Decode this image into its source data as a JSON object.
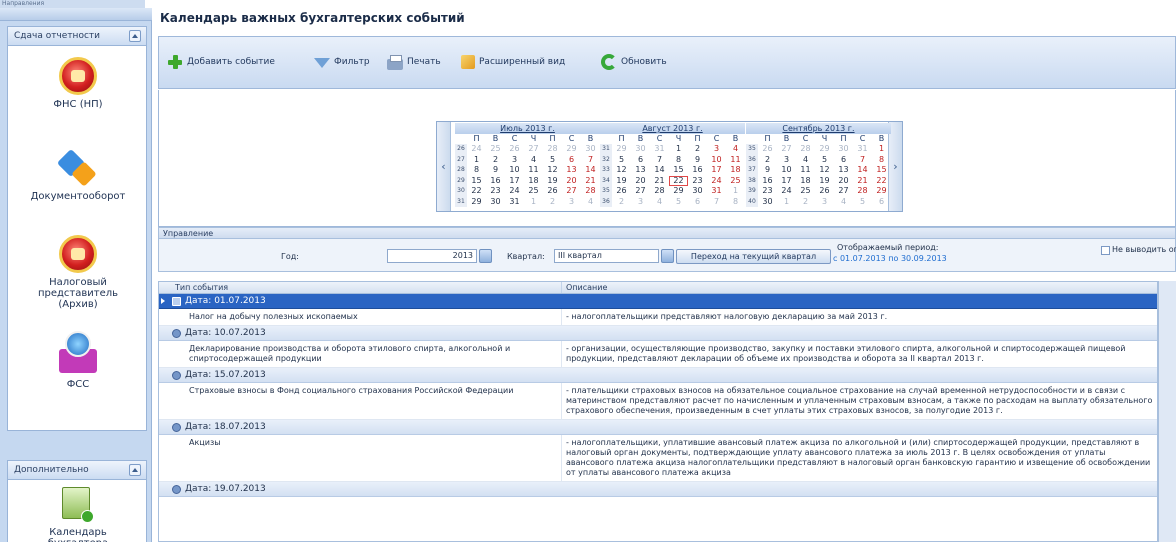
{
  "window": {
    "top_label": "Направления",
    "title": "Календарь важных бухгалтерских событий"
  },
  "nav": {
    "panel1_title": "Сдача отчетности",
    "panel2_title": "Дополнительно",
    "items": [
      {
        "label": "ФНС (НП)",
        "icon": "fns-eagle-icon"
      },
      {
        "label": "Документооборот",
        "icon": "docflow-icon"
      },
      {
        "label": "Налоговый представитель (Архив)",
        "icon": "tax-rep-eagle-icon"
      },
      {
        "label": "ФСС",
        "icon": "fss-icon"
      },
      {
        "label": "Календарь бухгалтера",
        "icon": "calendar-icon"
      }
    ]
  },
  "toolbar": {
    "add": "Добавить событие",
    "filter": "Фильтр",
    "print": "Печать",
    "extended": "Расширенный вид",
    "refresh": "Обновить"
  },
  "calendar": {
    "weekdays": [
      "П",
      "В",
      "С",
      "Ч",
      "П",
      "С",
      "В"
    ],
    "months": [
      {
        "title": "Июль 2013 г.",
        "weeks": [
          {
            "n": "26",
            "days": [
              "24",
              "25",
              "26",
              "27",
              "28",
              "29",
              "30"
            ]
          },
          {
            "n": "27",
            "days": [
              "1",
              "2",
              "3",
              "4",
              "5",
              "6",
              "7"
            ]
          },
          {
            "n": "28",
            "days": [
              "8",
              "9",
              "10",
              "11",
              "12",
              "13",
              "14"
            ]
          },
          {
            "n": "29",
            "days": [
              "15",
              "16",
              "17",
              "18",
              "19",
              "20",
              "21"
            ]
          },
          {
            "n": "30",
            "days": [
              "22",
              "23",
              "24",
              "25",
              "26",
              "27",
              "28"
            ]
          },
          {
            "n": "31",
            "days": [
              "29",
              "30",
              "31",
              "1",
              "2",
              "3",
              "4"
            ]
          }
        ]
      },
      {
        "title": "Август 2013 г.",
        "weeks": [
          {
            "n": "31",
            "days": [
              "29",
              "30",
              "31",
              "1",
              "2",
              "3",
              "4"
            ]
          },
          {
            "n": "32",
            "days": [
              "5",
              "6",
              "7",
              "8",
              "9",
              "10",
              "11"
            ]
          },
          {
            "n": "33",
            "days": [
              "12",
              "13",
              "14",
              "15",
              "16",
              "17",
              "18"
            ]
          },
          {
            "n": "34",
            "days": [
              "19",
              "20",
              "21",
              "22",
              "23",
              "24",
              "25"
            ]
          },
          {
            "n": "35",
            "days": [
              "26",
              "27",
              "28",
              "29",
              "30",
              "31",
              "1"
            ]
          },
          {
            "n": "36",
            "days": [
              "2",
              "3",
              "4",
              "5",
              "6",
              "7",
              "8"
            ]
          }
        ]
      },
      {
        "title": "Сентябрь 2013 г.",
        "weeks": [
          {
            "n": "35",
            "days": [
              "26",
              "27",
              "28",
              "29",
              "30",
              "31",
              "1"
            ]
          },
          {
            "n": "36",
            "days": [
              "2",
              "3",
              "4",
              "5",
              "6",
              "7",
              "8"
            ]
          },
          {
            "n": "37",
            "days": [
              "9",
              "10",
              "11",
              "12",
              "13",
              "14",
              "15"
            ]
          },
          {
            "n": "38",
            "days": [
              "16",
              "17",
              "18",
              "19",
              "20",
              "21",
              "22"
            ]
          },
          {
            "n": "39",
            "days": [
              "23",
              "24",
              "25",
              "26",
              "27",
              "28",
              "29"
            ]
          },
          {
            "n": "40",
            "days": [
              "30",
              "1",
              "2",
              "3",
              "4",
              "5",
              "6"
            ]
          }
        ]
      }
    ]
  },
  "management": {
    "header": "Управление",
    "year_label": "Год:",
    "year_value": "2013",
    "quarter_label": "Квартал:",
    "quarter_value": "III квартал",
    "current_quarter_button": "Переход на текущий квартал",
    "period_label": "Отображаемый период:",
    "period_value": "с 01.07.2013   по 30.09.2013",
    "no_alerts_label": "Не выводить оповещения"
  },
  "grid": {
    "col_type": "Тип события",
    "col_desc": "Описание",
    "groups": [
      {
        "label": "Дата: 01.07.2013",
        "rows": [
          {
            "type": "Налог на добычу полезных ископаемых",
            "desc": "- налогоплательщики представляют налоговую декларацию за май 2013 г."
          }
        ]
      },
      {
        "label": "Дата: 10.07.2013",
        "rows": [
          {
            "type": "Декларирование производства и оборота этилового спирта, алкогольной и спиртосодержащей продукции",
            "desc": "- организации, осуществляющие производство, закупку и поставки этилового спирта, алкогольной и спиртосодержащей пищевой продукции, представляют декларации об объеме их производства и оборота за II квартал 2013 г."
          }
        ]
      },
      {
        "label": "Дата: 15.07.2013",
        "rows": [
          {
            "type": "Страховые взносы в Фонд социального страхования Российской Федерации",
            "desc": "- плательщики страховых взносов на обязательное социальное страхование на случай временной нетрудоспособности и в связи с материнством представляют расчет по начисленным и уплаченным страховым взносам, а также по расходам на выплату обязательного страхового обеспечения, произведенным в счет уплаты этих страховых взносов, за полугодие 2013 г."
          }
        ]
      },
      {
        "label": "Дата: 18.07.2013",
        "rows": [
          {
            "type": "Акцизы",
            "desc": "- налогоплательщики, уплатившие авансовый платеж акциза по алкогольной и (или) спиртосодержащей продукции, представляют в налоговый орган документы, подтверждающие уплату авансового платежа за июль 2013 г. В целях освобождения от уплаты авансового платежа акциза налогоплательщики представляют в налоговый орган банковскую гарантию и извещение об освобождении от уплаты авансового платежа акциза"
          }
        ]
      },
      {
        "label": "Дата: 19.07.2013",
        "rows": []
      }
    ]
  }
}
